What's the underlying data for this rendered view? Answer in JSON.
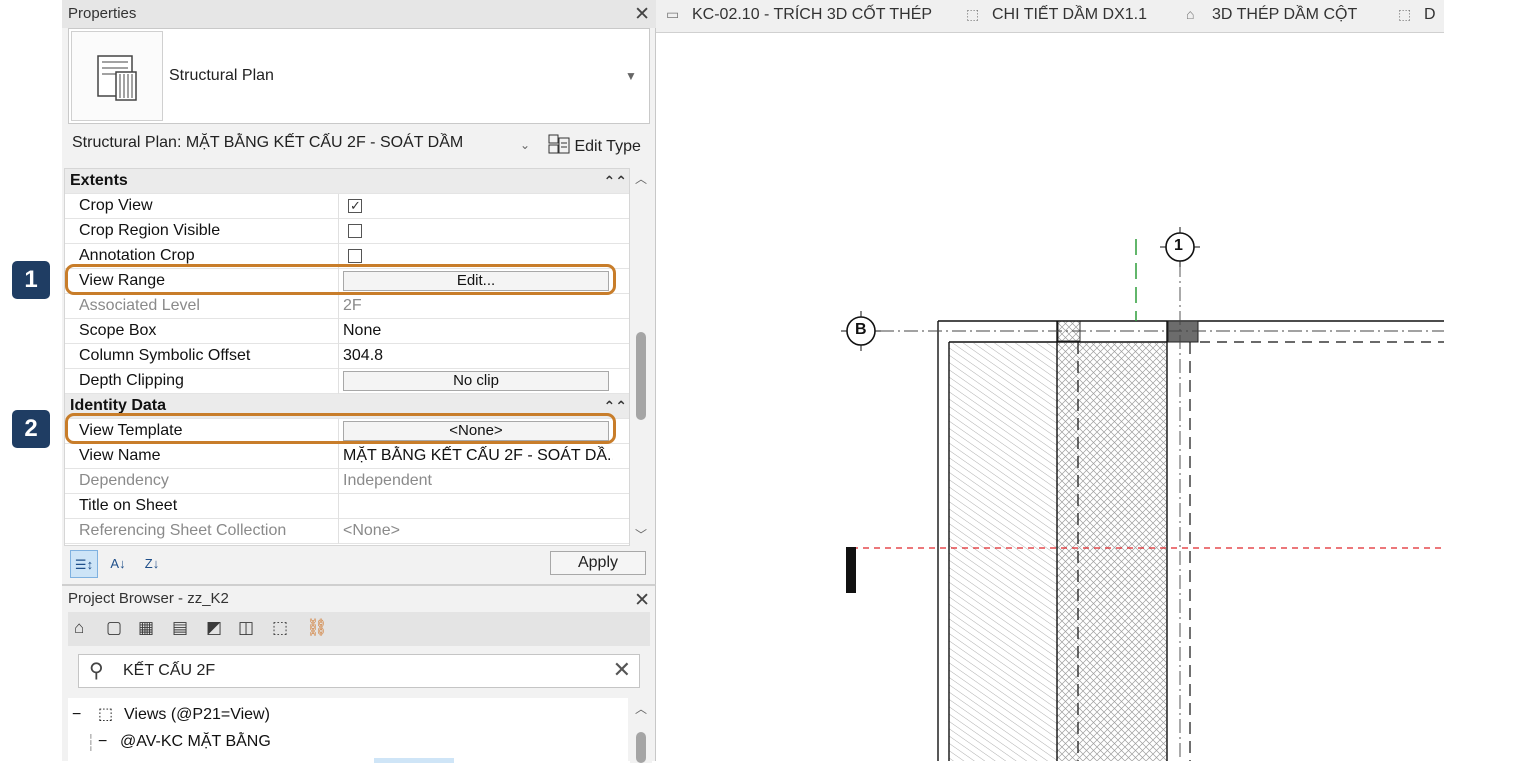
{
  "badges": {
    "b1": "1",
    "b2": "2"
  },
  "properties": {
    "title": "Properties",
    "type_name": "Structural Plan",
    "instance_selector": "Structural Plan: MẶT BẰNG KẾT CẤU 2F - SOÁT DẦM",
    "edit_type": "Edit Type",
    "sections": {
      "extents": "Extents",
      "identity": "Identity Data"
    },
    "rows": {
      "crop_view": {
        "name": "Crop View",
        "checked": true
      },
      "crop_region_visible": {
        "name": "Crop Region Visible",
        "checked": false
      },
      "annotation_crop": {
        "name": "Annotation Crop",
        "checked": false
      },
      "view_range": {
        "name": "View Range",
        "value": "Edit..."
      },
      "associated_level": {
        "name": "Associated Level",
        "value": "2F"
      },
      "scope_box": {
        "name": "Scope Box",
        "value": "None"
      },
      "column_symbolic_offset": {
        "name": "Column Symbolic Offset",
        "value": "304.8"
      },
      "depth_clipping": {
        "name": "Depth Clipping",
        "value": "No clip"
      },
      "view_template": {
        "name": "View Template",
        "value": "<None>"
      },
      "view_name": {
        "name": "View Name",
        "value": "MẶT BẰNG KẾT CẤU 2F - SOÁT DẦ..."
      },
      "dependency": {
        "name": "Dependency",
        "value": "Independent"
      },
      "title_on_sheet": {
        "name": "Title on Sheet",
        "value": ""
      },
      "referencing_sheet_collection": {
        "name": "Referencing Sheet Collection",
        "value": "<None>"
      }
    },
    "apply": "Apply"
  },
  "browser": {
    "title": "Project Browser - zz_K2",
    "search_value": "KẾT CẤU 2F",
    "tree": {
      "views": "Views (@P21=View)",
      "group": "@AV-KC MẶT BẰNG"
    }
  },
  "tabs": [
    {
      "label": "KC-02.10 - TRÍCH 3D CỐT THÉP",
      "icon": "sheet-icon"
    },
    {
      "label": "CHI TIẾT DẦM DX1.1",
      "icon": "section-view-icon"
    },
    {
      "label": "3D THÉP DẦM CỘT",
      "icon": "3d-house-icon"
    },
    {
      "label": "D",
      "icon": "section-view-icon"
    }
  ],
  "canvas": {
    "grid_bubble_1": "1",
    "grid_bubble_b": "B"
  },
  "colors": {
    "highlight": "#c87d2a",
    "badge": "#1f3d63",
    "green_dash": "#2e9e3a",
    "red_dash": "#e0262a"
  }
}
